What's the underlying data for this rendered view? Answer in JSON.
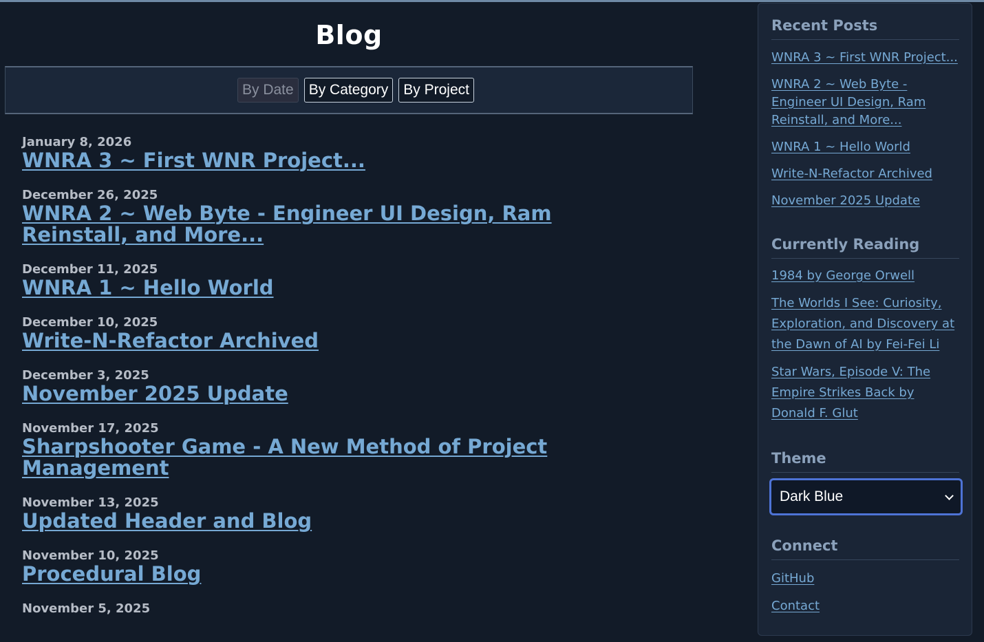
{
  "header": {
    "title": "Blog"
  },
  "filters": {
    "by_date": "By Date",
    "by_category": "By Category",
    "by_project": "By Project"
  },
  "posts": [
    {
      "date": "January 8, 2026",
      "title": "WNRA 3 ~ First WNR Project..."
    },
    {
      "date": "December 26, 2025",
      "title": "WNRA 2 ~ Web Byte - Engineer UI Design, Ram Reinstall, and More..."
    },
    {
      "date": "December 11, 2025",
      "title": "WNRA 1 ~ Hello World"
    },
    {
      "date": "December 10, 2025",
      "title": "Write-N-Refactor Archived"
    },
    {
      "date": "December 3, 2025",
      "title": "November 2025 Update"
    },
    {
      "date": "November 17, 2025",
      "title": "Sharpshooter Game - A New Method of Project Management"
    },
    {
      "date": "November 13, 2025",
      "title": "Updated Header and Blog"
    },
    {
      "date": "November 10, 2025",
      "title": "Procedural Blog"
    },
    {
      "date": "November 5, 2025",
      "title": ""
    }
  ],
  "sidebar": {
    "recent": {
      "heading": "Recent Posts",
      "items": [
        "WNRA 3 ~ First WNR Project...",
        "WNRA 2 ~ Web Byte - Engineer UI Design, Ram Reinstall, and More...",
        "WNRA 1 ~ Hello World",
        "Write-N-Refactor Archived",
        "November 2025 Update"
      ]
    },
    "reading": {
      "heading": "Currently Reading",
      "items": [
        "1984 by George Orwell",
        "The Worlds I See: Curiosity, Exploration, and Discovery at the Dawn of AI by Fei-Fei Li",
        "Star Wars, Episode V: The Empire Strikes Back by Donald F. Glut"
      ]
    },
    "theme": {
      "heading": "Theme",
      "selected": "Dark Blue"
    },
    "connect": {
      "heading": "Connect",
      "items": [
        "GitHub",
        "Contact"
      ]
    }
  },
  "colors": {
    "background": "#121b28",
    "link": "#76a9d4",
    "accent": "#4e73d6"
  }
}
